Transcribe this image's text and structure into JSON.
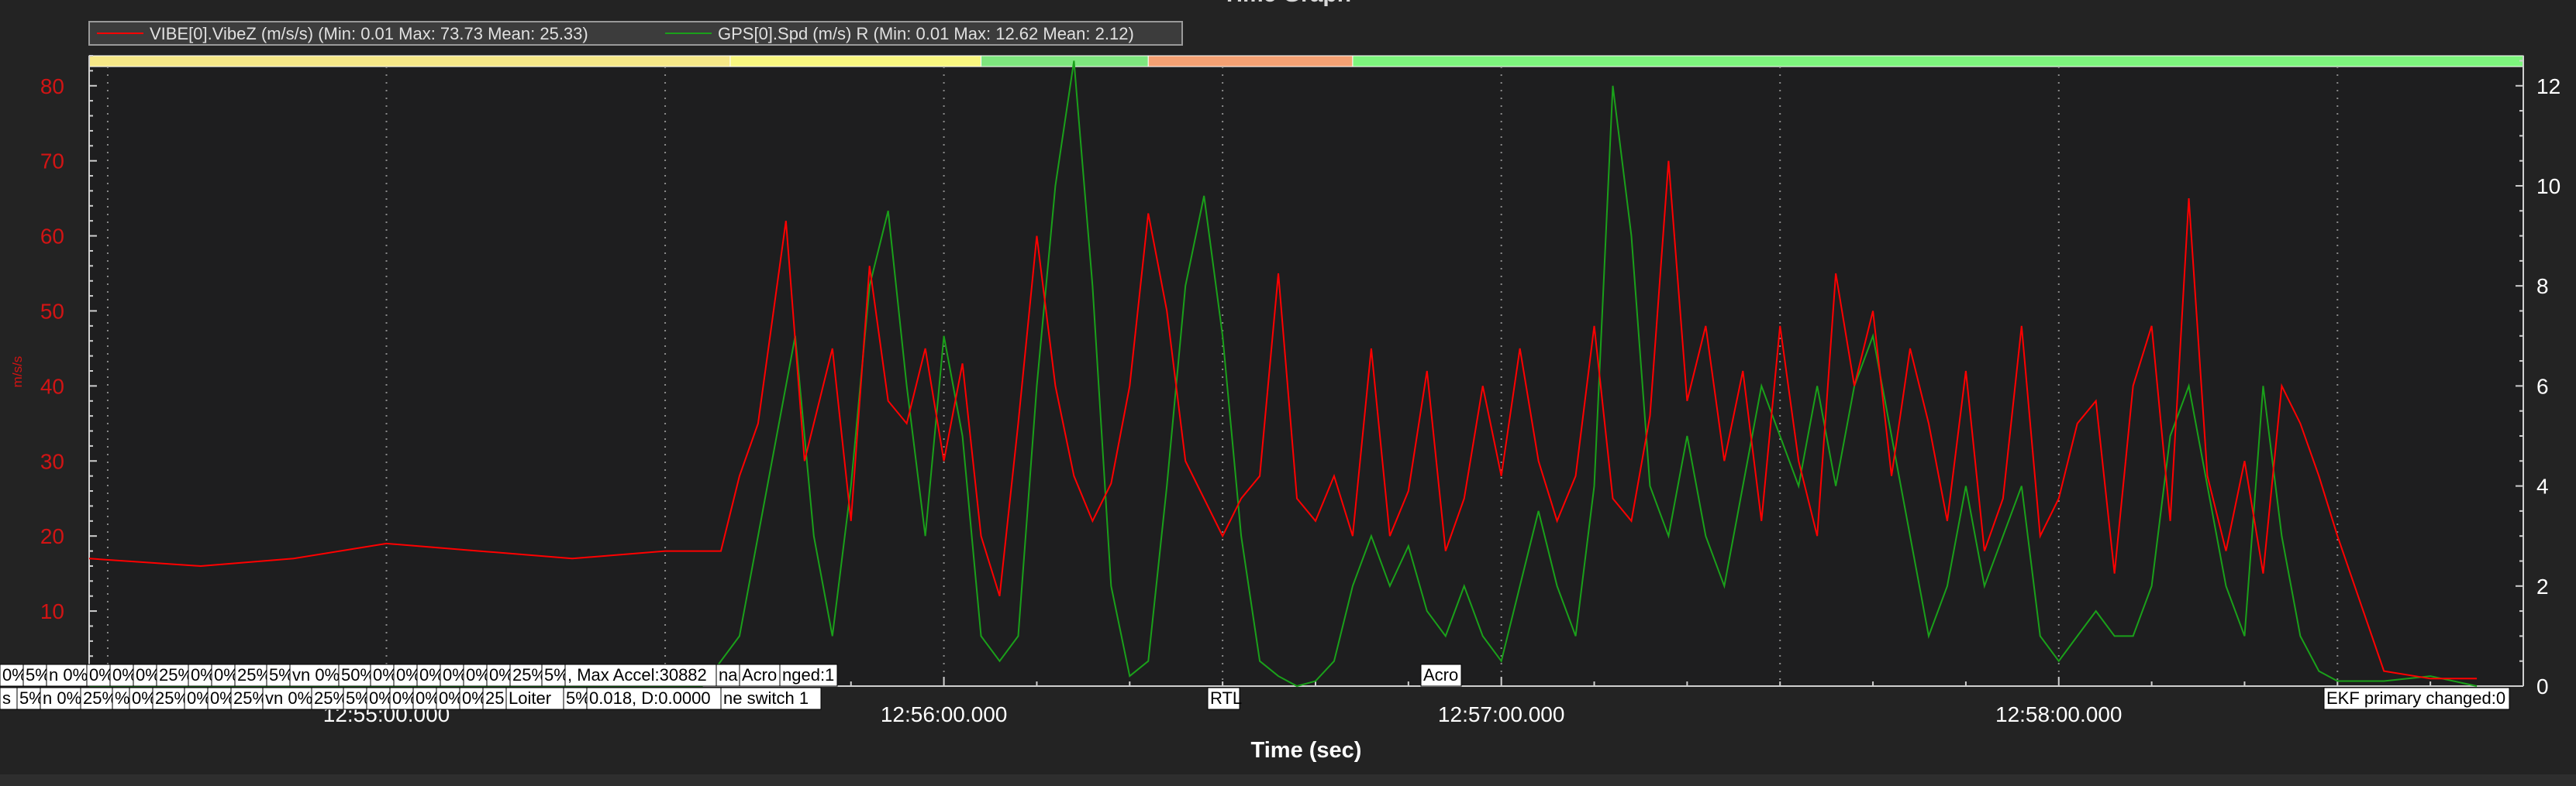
{
  "graph_title": "Time Graph",
  "legend": [
    {
      "name": "VIBE[0].VibeZ (m/s/s)  (Min: 0.01 Max: 73.73 Mean: 25.33)",
      "color": "#ff0000"
    },
    {
      "name": "GPS[0].Spd (m/s)  R (Min: 0.01 Max: 12.62 Mean: 2.12)",
      "color": "#1aa01a"
    }
  ],
  "mode_colors": [
    "#f6e887",
    "#f9f77f",
    "#7ee67e",
    "#f5a173",
    "#7df57d"
  ],
  "message_rows": [
    [
      "0%",
      "5%",
      "n 0%",
      "0%",
      "0%",
      "0%",
      "25%",
      "0%",
      "0%",
      "25%",
      "5%",
      "vn 0%",
      "50%",
      "0%",
      "0%",
      "0%",
      "0%",
      "0%",
      "0%",
      "25%",
      "5%",
      ", Max Accel:30882",
      "na",
      "Acro",
      "nged:1"
    ],
    [
      "s",
      "5%",
      "n 0%",
      "25%",
      "%",
      "0%",
      "25%",
      "0%",
      "0%",
      "25%",
      "vn 0%",
      "25%",
      "5%",
      "0%",
      "0%",
      "0%",
      "0%",
      "0%",
      "25",
      "Loiter",
      "5%",
      "0.018, D:0.0000",
      "ne switch 1"
    ]
  ],
  "extra_messages": [
    "RTL",
    "Acro",
    "EKF primary changed:0"
  ],
  "chart_data": {
    "type": "line",
    "title": "Time Graph",
    "xlabel": "Time (sec)",
    "ylabel": "m/s/s",
    "x_ticks": [
      "12:55:00.000",
      "12:56:00.000",
      "12:57:00.000",
      "12:58:00.000"
    ],
    "x_range_sec": [
      -32,
      230
    ],
    "y_left": {
      "range": [
        0,
        84
      ],
      "ticks": [
        10,
        20,
        30,
        40,
        50,
        60,
        70,
        80
      ],
      "color": "#d21414"
    },
    "y_right": {
      "range": [
        0,
        12.6
      ],
      "ticks": [
        0,
        2,
        4,
        6,
        8,
        10,
        12
      ]
    },
    "mode_bands": [
      {
        "start": -32,
        "end": 37,
        "color": "#f6e887"
      },
      {
        "start": 37,
        "end": 64,
        "color": "#f9f77f"
      },
      {
        "start": 64,
        "end": 82,
        "color": "#7ee67e"
      },
      {
        "start": 82,
        "end": 104,
        "color": "#f5a173"
      },
      {
        "start": 104,
        "end": 230,
        "color": "#7df57d"
      }
    ],
    "series": [
      {
        "name": "VIBE[0].VibeZ (m/s/s)",
        "color": "#ff0000",
        "axis": "left",
        "x": [
          -32,
          -20,
          -10,
          0,
          10,
          20,
          30,
          36,
          38,
          40,
          43,
          45,
          48,
          50,
          52,
          54,
          56,
          58,
          60,
          62,
          64,
          66,
          68,
          70,
          72,
          74,
          76,
          78,
          80,
          82,
          84,
          86,
          88,
          90,
          92,
          94,
          96,
          98,
          100,
          102,
          104,
          106,
          108,
          110,
          112,
          114,
          116,
          118,
          120,
          122,
          124,
          126,
          128,
          130,
          132,
          134,
          136,
          138,
          140,
          142,
          144,
          146,
          148,
          150,
          152,
          154,
          156,
          158,
          160,
          162,
          164,
          166,
          168,
          170,
          172,
          174,
          176,
          178,
          180,
          182,
          184,
          186,
          188,
          190,
          192,
          194,
          196,
          198,
          200,
          202,
          204,
          206,
          208,
          210,
          215,
          220,
          225
        ],
        "y": [
          17,
          16,
          17,
          19,
          18,
          17,
          18,
          18,
          28,
          35,
          62,
          30,
          45,
          22,
          56,
          38,
          35,
          45,
          30,
          43,
          20,
          12,
          35,
          60,
          40,
          28,
          22,
          27,
          40,
          63,
          50,
          30,
          25,
          20,
          25,
          28,
          55,
          25,
          22,
          28,
          20,
          45,
          20,
          26,
          42,
          18,
          25,
          40,
          28,
          45,
          30,
          22,
          28,
          48,
          25,
          22,
          36,
          70,
          38,
          48,
          30,
          42,
          22,
          48,
          30,
          20,
          55,
          40,
          50,
          28,
          45,
          35,
          22,
          42,
          18,
          25,
          48,
          20,
          25,
          35,
          38,
          15,
          40,
          48,
          22,
          65,
          28,
          18,
          30,
          15,
          40,
          35,
          28,
          20,
          2,
          1,
          1
        ]
      },
      {
        "name": "GPS[0].Spd (m/s)",
        "color": "#1aa01a",
        "axis": "right",
        "x": [
          -32,
          0,
          30,
          34,
          38,
          42,
          44,
          46,
          48,
          50,
          52,
          54,
          56,
          58,
          60,
          62,
          64,
          66,
          68,
          70,
          72,
          74,
          76,
          78,
          80,
          82,
          84,
          86,
          88,
          90,
          92,
          94,
          96,
          98,
          100,
          102,
          104,
          106,
          108,
          110,
          112,
          114,
          116,
          118,
          120,
          122,
          124,
          126,
          128,
          130,
          132,
          134,
          136,
          138,
          140,
          142,
          144,
          146,
          148,
          150,
          152,
          154,
          156,
          158,
          160,
          162,
          164,
          166,
          168,
          170,
          172,
          174,
          176,
          178,
          180,
          182,
          184,
          186,
          188,
          190,
          192,
          194,
          196,
          198,
          200,
          202,
          204,
          206,
          208,
          210,
          215,
          220,
          225
        ],
        "y": [
          0,
          0,
          0,
          0,
          1,
          5,
          7,
          3,
          1,
          4,
          8,
          9.5,
          6,
          3,
          7,
          5,
          1,
          0.5,
          1,
          6,
          10,
          12.5,
          8,
          2,
          0.2,
          0.5,
          4,
          8,
          9.8,
          7,
          3,
          0.5,
          0.2,
          0,
          0.1,
          0.5,
          2,
          3,
          2,
          2.8,
          1.5,
          1,
          2,
          1,
          0.5,
          2,
          3.5,
          2,
          1,
          4,
          12,
          9,
          4,
          3,
          5,
          3,
          2,
          4,
          6,
          5,
          4,
          6,
          4,
          6,
          7,
          5,
          3,
          1,
          2,
          4,
          2,
          3,
          4,
          1,
          0.5,
          1,
          1.5,
          1,
          1,
          2,
          5,
          6,
          4,
          2,
          1,
          6,
          3,
          1,
          0.3,
          0.1,
          0.1,
          0.2,
          0
        ]
      }
    ]
  }
}
